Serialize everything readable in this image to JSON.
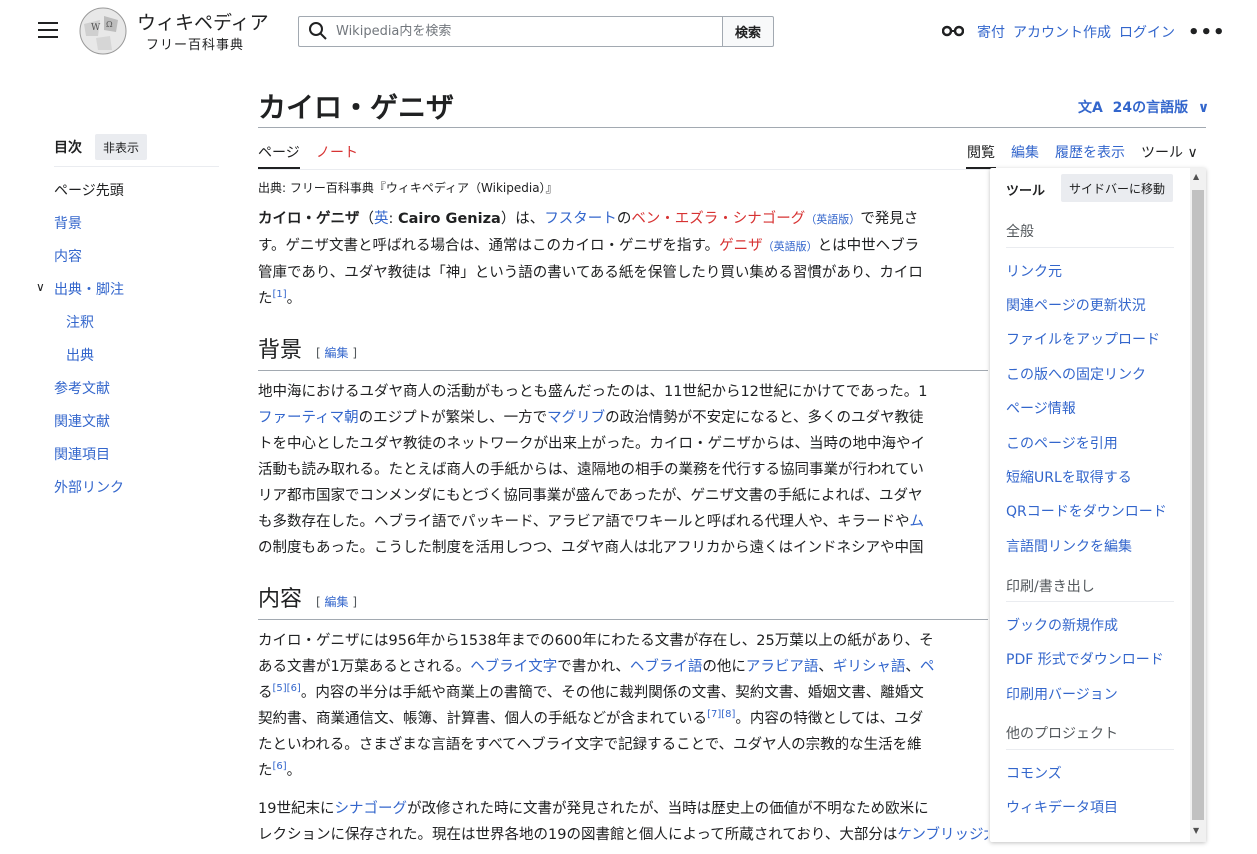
{
  "header": {
    "wordmark": "ウィキペディア",
    "tagline": "フリー百科事典",
    "search_placeholder": "Wikipedia内を検索",
    "search_button": "検索",
    "donate": "寄付",
    "create_account": "アカウント作成",
    "login": "ログイン"
  },
  "toc": {
    "title": "目次",
    "hide": "非表示",
    "items": [
      "ページ先頭",
      "背景",
      "内容",
      "出典・脚注",
      "注釈",
      "出典",
      "参考文献",
      "関連文献",
      "関連項目",
      "外部リンク"
    ]
  },
  "article": {
    "title": "カイロ・ゲニザ",
    "languages": "24の言語版",
    "tabs": {
      "page": "ページ",
      "talk": "ノート",
      "read": "閲覧",
      "edit": "編集",
      "history": "履歴を表示",
      "tools": "ツール"
    },
    "from": "出典: フリー百科事典『ウィキペディア（Wikipedia）』",
    "sections": {
      "background": "背景",
      "content": "内容",
      "edit": "編集"
    }
  },
  "tools_panel": {
    "title": "ツール",
    "move": "サイドバーに移動",
    "general": "全般",
    "general_items": [
      "リンク元",
      "関連ページの更新状況",
      "ファイルをアップロード",
      "この版への固定リンク",
      "ページ情報",
      "このページを引用",
      "短縮URLを取得する",
      "QRコードをダウンロード",
      "言語間リンクを編集"
    ],
    "print": "印刷/書き出し",
    "print_items": [
      "ブックの新規作成",
      "PDF 形式でダウンロード",
      "印刷用バージョン"
    ],
    "other": "他のプロジェクト",
    "other_items": [
      "コモンズ",
      "ウィキデータ項目"
    ]
  }
}
